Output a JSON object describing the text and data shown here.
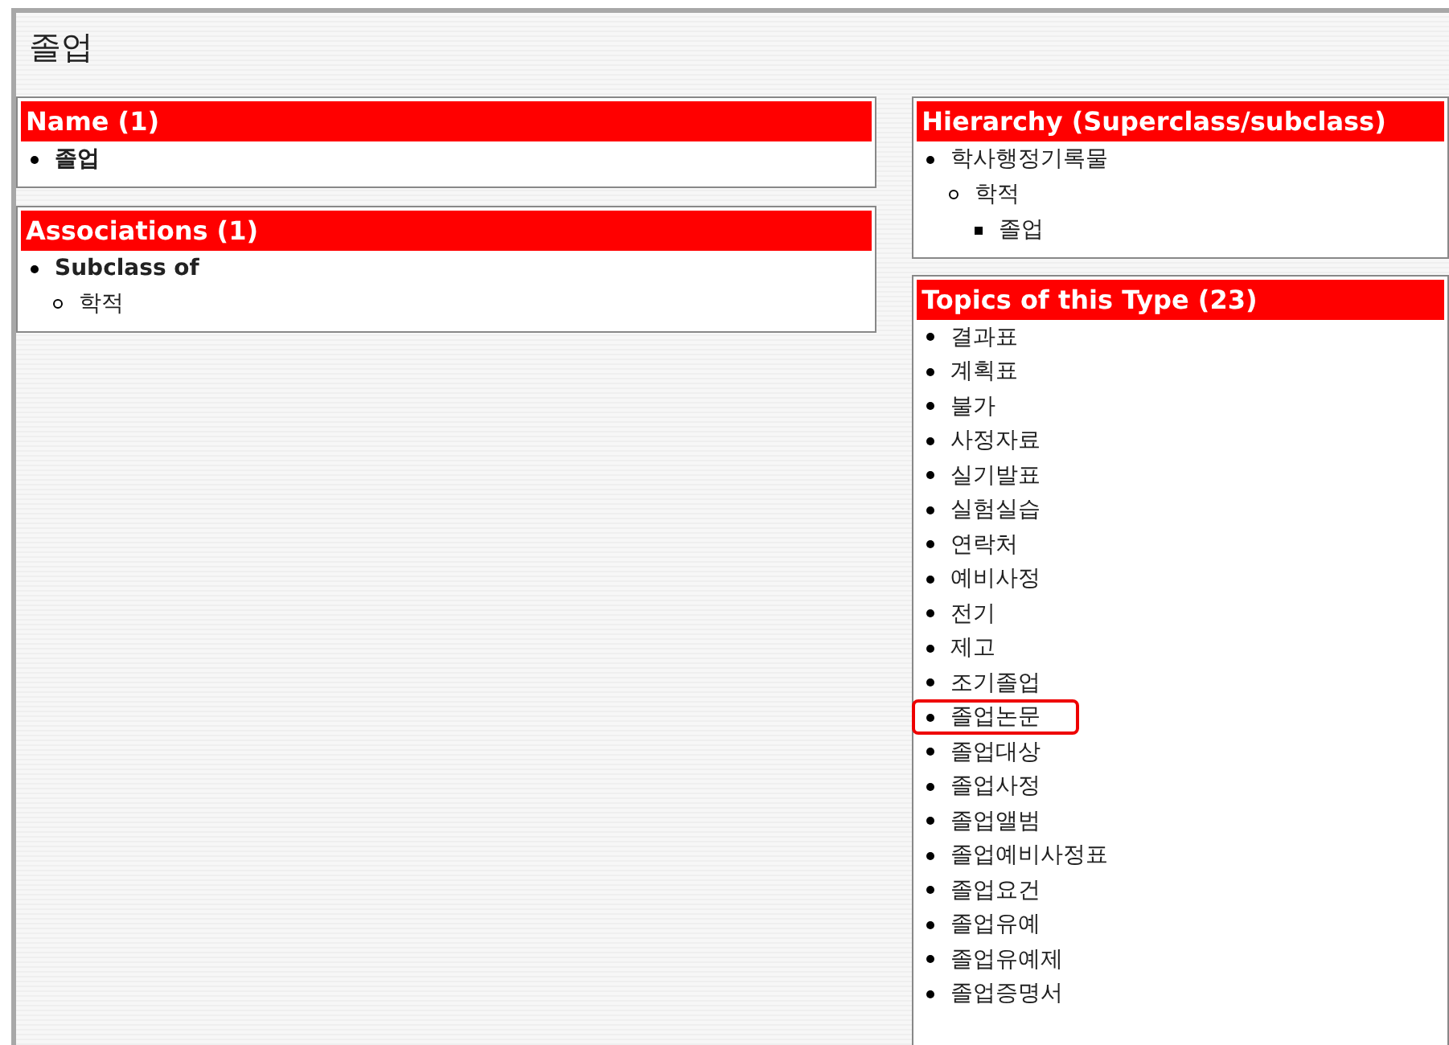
{
  "page_title": "졸업",
  "name_panel": {
    "heading": "Name (1)",
    "items": [
      "졸업"
    ]
  },
  "associations_panel": {
    "heading": "Associations (1)",
    "items": [
      {
        "label": "Subclass of",
        "children": [
          "학적"
        ]
      }
    ]
  },
  "hierarchy_panel": {
    "heading": "Hierarchy (Superclass/subclass)",
    "tree": [
      {
        "label": "학사행정기록물",
        "children": [
          {
            "label": "학적",
            "children": [
              {
                "label": "졸업"
              }
            ]
          }
        ]
      }
    ]
  },
  "topics_panel": {
    "heading": "Topics of this Type (23)",
    "items": [
      {
        "label": "결과표",
        "highlighted": false
      },
      {
        "label": "계획표",
        "highlighted": false
      },
      {
        "label": "불가",
        "highlighted": false
      },
      {
        "label": "사정자료",
        "highlighted": false
      },
      {
        "label": "실기발표",
        "highlighted": false
      },
      {
        "label": "실험실습",
        "highlighted": false
      },
      {
        "label": "연락처",
        "highlighted": false
      },
      {
        "label": "예비사정",
        "highlighted": false
      },
      {
        "label": "전기",
        "highlighted": false
      },
      {
        "label": "제고",
        "highlighted": false
      },
      {
        "label": "조기졸업",
        "highlighted": false
      },
      {
        "label": "졸업논문",
        "highlighted": true
      },
      {
        "label": "졸업대상",
        "highlighted": false
      },
      {
        "label": "졸업사정",
        "highlighted": false
      },
      {
        "label": "졸업앨범",
        "highlighted": false
      },
      {
        "label": "졸업예비사정표",
        "highlighted": false
      },
      {
        "label": "졸업요건",
        "highlighted": false
      },
      {
        "label": "졸업유예",
        "highlighted": false
      },
      {
        "label": "졸업유예제",
        "highlighted": false
      },
      {
        "label": "졸업증명서",
        "highlighted": false
      }
    ]
  }
}
